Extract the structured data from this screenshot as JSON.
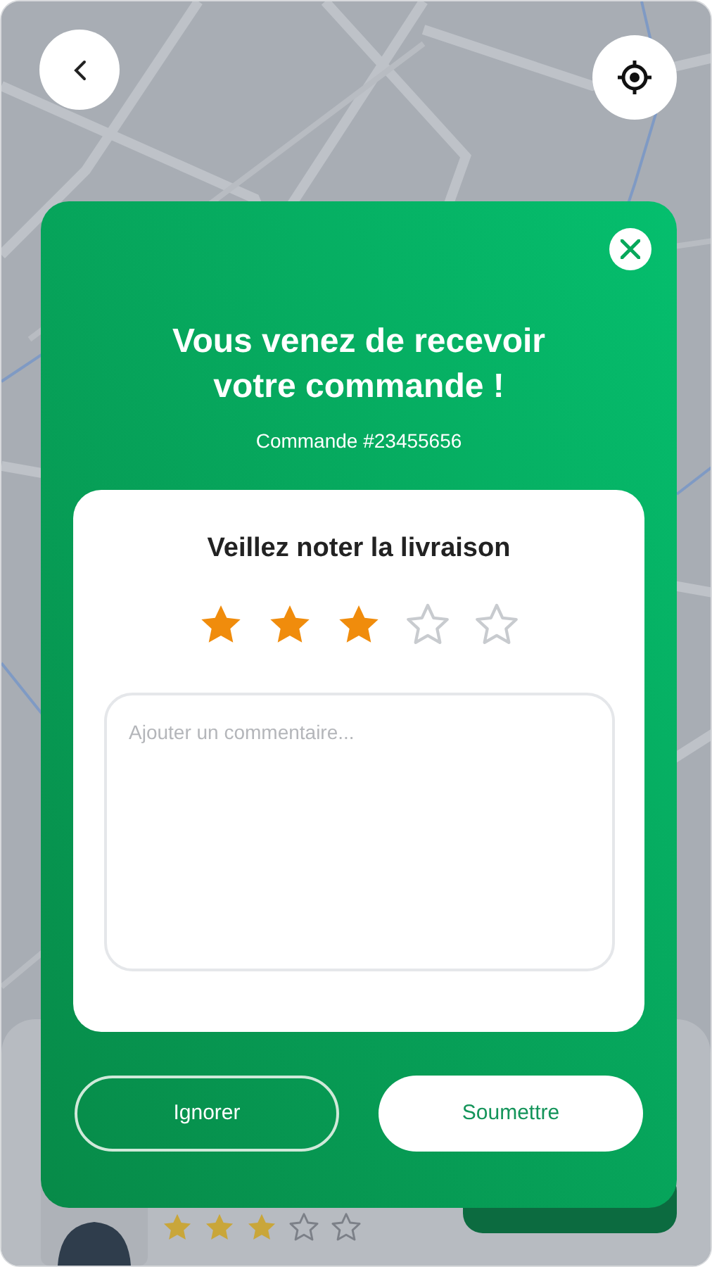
{
  "dialog": {
    "title": "Vous venez de recevoir votre commande !",
    "order": "Commande #23455656",
    "rating": {
      "prompt": "Veillez noter la livraison",
      "stars": 3
    },
    "comment": {
      "placeholder": "Ajouter un commentaire..."
    },
    "buttons": [
      {
        "label": "Ignorer",
        "kind": "outline"
      },
      {
        "label": "Soumettre",
        "kind": "filled"
      }
    ]
  },
  "courier": {
    "stars": 3
  }
}
